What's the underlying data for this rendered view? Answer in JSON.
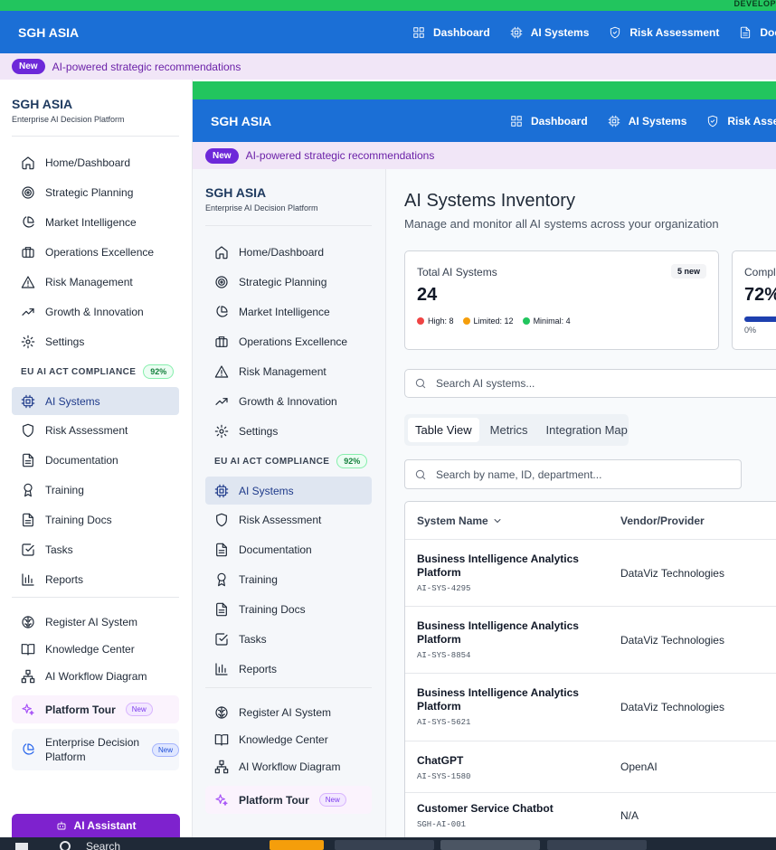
{
  "outer": {
    "dev_label": "DEVELOP",
    "brand": "SGH ASIA",
    "nav": [
      {
        "label": "Dashboard",
        "icon": "grid-icon"
      },
      {
        "label": "AI Systems",
        "icon": "cpu-icon"
      },
      {
        "label": "Risk Assessment",
        "icon": "shield-check-icon"
      },
      {
        "label": "Docu",
        "icon": "document-icon"
      }
    ],
    "announcement": {
      "badge": "New",
      "text": "AI-powered strategic recommendations"
    },
    "sidebar": {
      "brand": "SGH ASIA",
      "subtitle": "Enterprise AI Decision Platform",
      "main_items": [
        {
          "label": "Home/Dashboard",
          "icon": "home-icon"
        },
        {
          "label": "Strategic Planning",
          "icon": "target-icon"
        },
        {
          "label": "Market Intelligence",
          "icon": "pie-chart-icon"
        },
        {
          "label": "Operations Excellence",
          "icon": "briefcase-icon"
        },
        {
          "label": "Risk Management",
          "icon": "warning-icon"
        },
        {
          "label": "Growth & Innovation",
          "icon": "trending-up-icon"
        },
        {
          "label": "Settings",
          "icon": "gear-icon"
        }
      ],
      "section": {
        "label": "EU AI ACT COMPLIANCE",
        "badge": "92%"
      },
      "compliance_items": [
        {
          "label": "AI Systems",
          "icon": "cpu-icon",
          "active": true
        },
        {
          "label": "Risk Assessment",
          "icon": "shield-icon"
        },
        {
          "label": "Documentation",
          "icon": "document-icon"
        },
        {
          "label": "Training",
          "icon": "award-icon"
        },
        {
          "label": "Training Docs",
          "icon": "document-icon"
        },
        {
          "label": "Tasks",
          "icon": "checkbox-icon"
        },
        {
          "label": "Reports",
          "icon": "bar-chart-icon"
        }
      ],
      "tool_items": [
        {
          "label": "Register AI System",
          "icon": "brain-icon"
        },
        {
          "label": "Knowledge Center",
          "icon": "book-icon"
        },
        {
          "label": "AI Workflow Diagram",
          "icon": "workflow-icon"
        }
      ],
      "platform_tour": {
        "label": "Platform Tour",
        "badge": "New"
      },
      "enterprise": {
        "label": "Enterprise Decision Platform",
        "badge": "New"
      },
      "ai_assistant": "AI Assistant"
    }
  },
  "inner": {
    "brand": "SGH ASIA",
    "nav": [
      {
        "label": "Dashboard"
      },
      {
        "label": "AI Systems"
      },
      {
        "label": "Risk Assessment"
      }
    ],
    "announcement": {
      "badge": "New",
      "text": "AI-powered strategic recommendations"
    },
    "sidebar": {
      "brand": "SGH ASIA",
      "subtitle": "Enterprise AI Decision Platform",
      "main_items": [
        {
          "label": "Home/Dashboard"
        },
        {
          "label": "Strategic Planning"
        },
        {
          "label": "Market Intelligence"
        },
        {
          "label": "Operations Excellence"
        },
        {
          "label": "Risk Management"
        },
        {
          "label": "Growth & Innovation"
        },
        {
          "label": "Settings"
        }
      ],
      "section": {
        "label": "EU AI ACT COMPLIANCE",
        "badge": "92%"
      },
      "compliance_items": [
        {
          "label": "AI Systems"
        },
        {
          "label": "Risk Assessment"
        },
        {
          "label": "Documentation"
        },
        {
          "label": "Training"
        },
        {
          "label": "Training Docs"
        },
        {
          "label": "Tasks"
        },
        {
          "label": "Reports"
        }
      ],
      "tool_items": [
        {
          "label": "Register AI System"
        },
        {
          "label": "Knowledge Center"
        },
        {
          "label": "AI Workflow Diagram"
        }
      ],
      "platform_tour": {
        "label": "Platform Tour",
        "badge": "New"
      }
    }
  },
  "page": {
    "title": "AI Systems Inventory",
    "subtitle": "Manage and monitor all AI systems across your organization",
    "stat_card": {
      "label": "Total AI Systems",
      "badge": "5 new",
      "value": "24",
      "breakdown": [
        {
          "label": "High: 8",
          "color": "#ef4444"
        },
        {
          "label": "Limited: 12",
          "color": "#f59e0b"
        },
        {
          "label": "Minimal: 4",
          "color": "#22c55e"
        }
      ]
    },
    "compliance_card": {
      "label": "Compli",
      "value": "72%",
      "progress": 0.72,
      "min_label": "0%"
    },
    "search_main": {
      "placeholder": "Search AI systems..."
    },
    "tabs": [
      {
        "label": "Table View",
        "active": true
      },
      {
        "label": "Metrics"
      },
      {
        "label": "Integration Map"
      }
    ],
    "search_table": {
      "placeholder": "Search by name, ID, department..."
    },
    "table": {
      "columns": [
        "System Name",
        "Vendor/Provider"
      ],
      "rows": [
        {
          "name": "Business Intelligence Analytics Platform",
          "id": "AI-SYS-4295",
          "vendor": "DataViz Technologies"
        },
        {
          "name": "Business Intelligence Analytics Platform",
          "id": "AI-SYS-8854",
          "vendor": "DataViz Technologies"
        },
        {
          "name": "Business Intelligence Analytics Platform",
          "id": "AI-SYS-5621",
          "vendor": "DataViz Technologies"
        },
        {
          "name": "ChatGPT",
          "id": "AI-SYS-1580",
          "vendor": "OpenAI"
        },
        {
          "name": "Customer Service Chatbot",
          "id": "SGH-AI-001",
          "vendor": "N/A"
        }
      ]
    }
  },
  "taskbar": {
    "search_label": "Search"
  }
}
